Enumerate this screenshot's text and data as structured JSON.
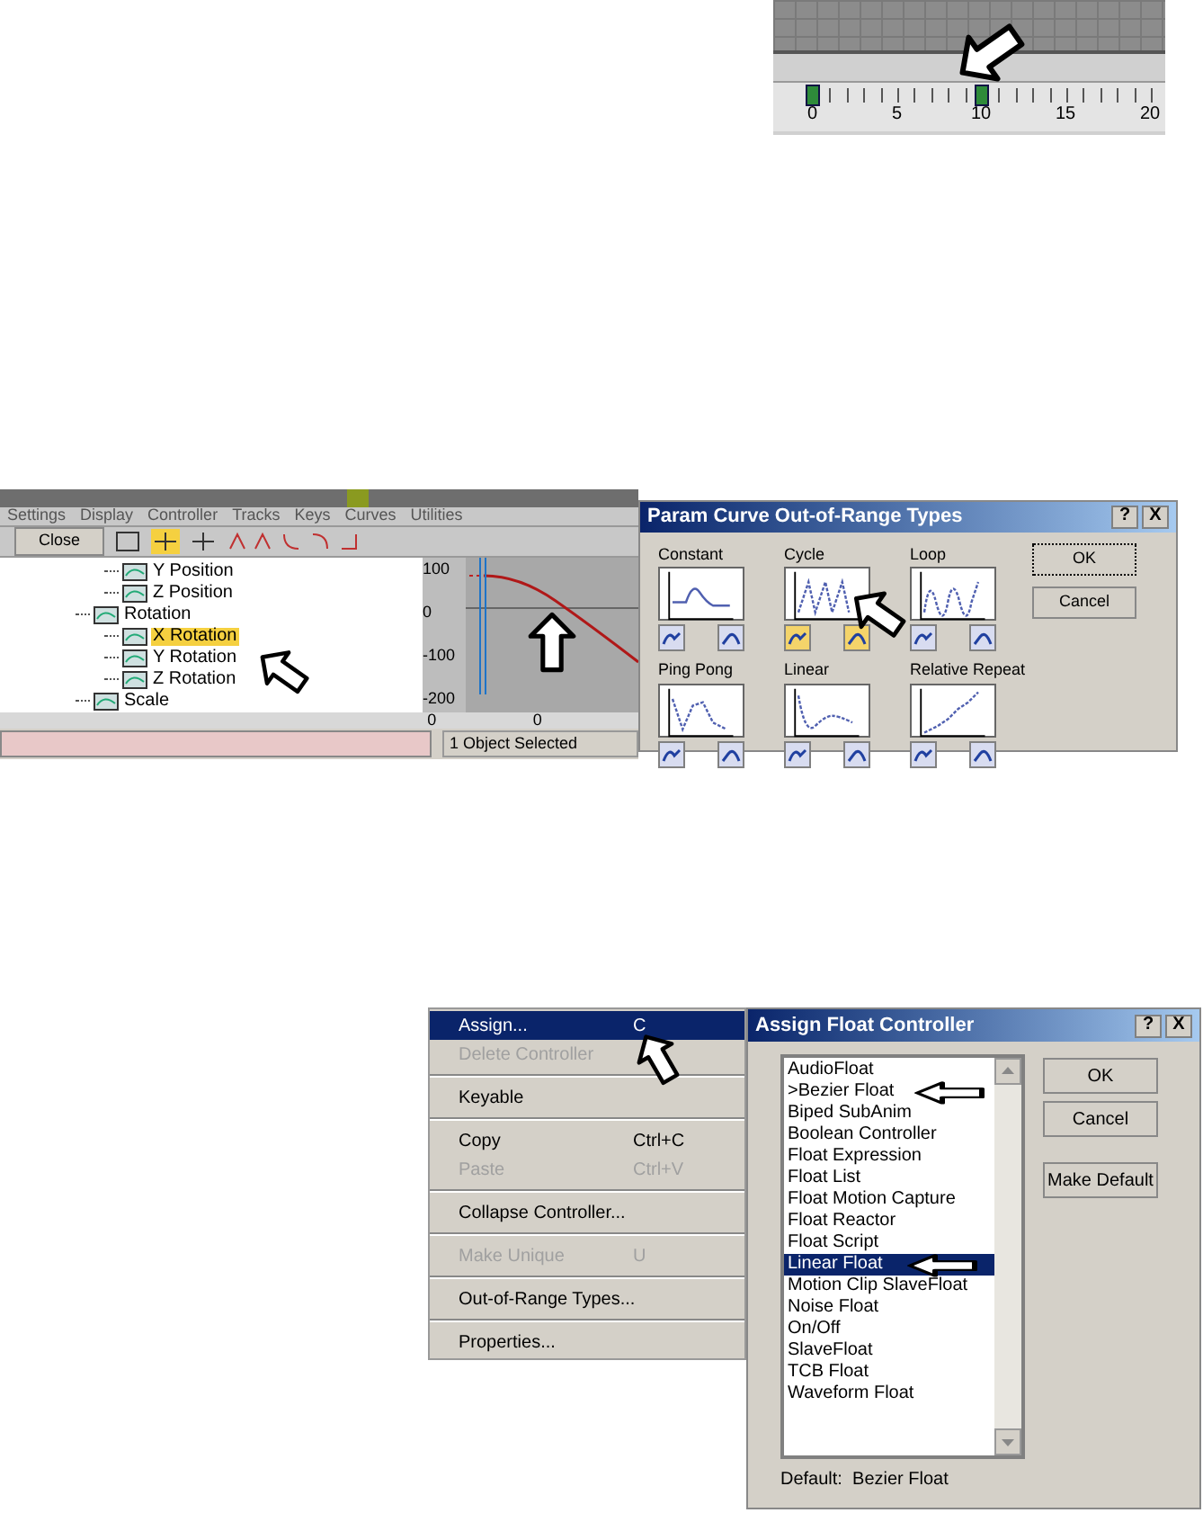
{
  "timeline": {
    "ruler": [
      {
        "label": "0",
        "key": true
      },
      {
        "label": "5",
        "key": false
      },
      {
        "label": "10",
        "key": true
      },
      {
        "label": "15",
        "key": false
      },
      {
        "label": "20",
        "key": false
      }
    ]
  },
  "track_view": {
    "menu": [
      "Settings",
      "Display",
      "Controller",
      "Tracks",
      "Keys",
      "Curves",
      "Utilities"
    ],
    "close_button": "Close",
    "position_tracks": [
      {
        "label": "Y Position",
        "selected": false
      },
      {
        "label": "Z Position",
        "selected": false
      }
    ],
    "tree": [
      {
        "label": "Rotation",
        "selected": false,
        "children": [
          {
            "label": "X Rotation",
            "selected": true
          },
          {
            "label": "Y Rotation",
            "selected": false
          },
          {
            "label": "Z Rotation",
            "selected": false
          }
        ]
      },
      {
        "label": "Scale",
        "selected": false
      }
    ],
    "graph_values": [
      "100",
      "0",
      "-100",
      "-200"
    ],
    "graph_frames": [
      "0",
      "0"
    ],
    "status": "1 Object Selected"
  },
  "out_of_range_dialog": {
    "title": "Param Curve Out-of-Range Types",
    "help": "?",
    "close": "X",
    "types": [
      {
        "label": "Constant",
        "kind": "constant",
        "in_on": false,
        "out_on": false
      },
      {
        "label": "Cycle",
        "kind": "cycle",
        "in_on": true,
        "out_on": true
      },
      {
        "label": "Loop",
        "kind": "loop",
        "in_on": false,
        "out_on": false
      },
      {
        "label": "Ping Pong",
        "kind": "pingpong",
        "in_on": false,
        "out_on": false
      },
      {
        "label": "Linear",
        "kind": "linear",
        "in_on": false,
        "out_on": false
      },
      {
        "label": "Relative Repeat",
        "kind": "relative",
        "in_on": false,
        "out_on": false
      }
    ],
    "buttons": [
      "OK",
      "Cancel"
    ]
  },
  "context_menu": [
    {
      "kind": "item",
      "label": "Assign...",
      "shortcut": "C",
      "highlighted": true,
      "disabled": false
    },
    {
      "kind": "item",
      "label": "Delete Controller",
      "highlighted": false,
      "disabled": true
    },
    {
      "kind": "separator"
    },
    {
      "kind": "item",
      "label": "Keyable",
      "highlighted": false,
      "disabled": false
    },
    {
      "kind": "separator"
    },
    {
      "kind": "item",
      "label": "Copy",
      "shortcut": "Ctrl+C",
      "highlighted": false,
      "disabled": false
    },
    {
      "kind": "item",
      "label": "Paste",
      "shortcut": "Ctrl+V",
      "highlighted": false,
      "disabled": true
    },
    {
      "kind": "separator"
    },
    {
      "kind": "item",
      "label": "Collapse Controller...",
      "highlighted": false,
      "disabled": false
    },
    {
      "kind": "separator"
    },
    {
      "kind": "item",
      "label": "Make Unique",
      "shortcut": "U",
      "highlighted": false,
      "disabled": true
    },
    {
      "kind": "separator"
    },
    {
      "kind": "item",
      "label": "Out-of-Range Types...",
      "highlighted": false,
      "disabled": false
    },
    {
      "kind": "separator"
    },
    {
      "kind": "item",
      "label": "Properties...",
      "highlighted": false,
      "disabled": false
    }
  ],
  "assign_dialog": {
    "title": "Assign Float Controller",
    "help": "?",
    "close": "X",
    "items": [
      {
        "label": "AudioFloat",
        "selected": false
      },
      {
        "label": ">Bezier Float",
        "selected": false
      },
      {
        "label": "Biped SubAnim",
        "selected": false
      },
      {
        "label": "Boolean Controller",
        "selected": false
      },
      {
        "label": "Float Expression",
        "selected": false
      },
      {
        "label": "Float List",
        "selected": false
      },
      {
        "label": "Float Motion Capture",
        "selected": false
      },
      {
        "label": "Float Reactor",
        "selected": false
      },
      {
        "label": "Float Script",
        "selected": false
      },
      {
        "label": "Linear Float",
        "selected": true
      },
      {
        "label": "Motion Clip SlaveFloat",
        "selected": false
      },
      {
        "label": "Noise Float",
        "selected": false
      },
      {
        "label": "On/Off",
        "selected": false
      },
      {
        "label": "SlaveFloat",
        "selected": false
      },
      {
        "label": "TCB Float",
        "selected": false
      },
      {
        "label": "Waveform Float",
        "selected": false
      }
    ],
    "buttons": [
      "OK",
      "Cancel",
      "Make Default"
    ],
    "default_label": "Default:  Bezier Float"
  }
}
